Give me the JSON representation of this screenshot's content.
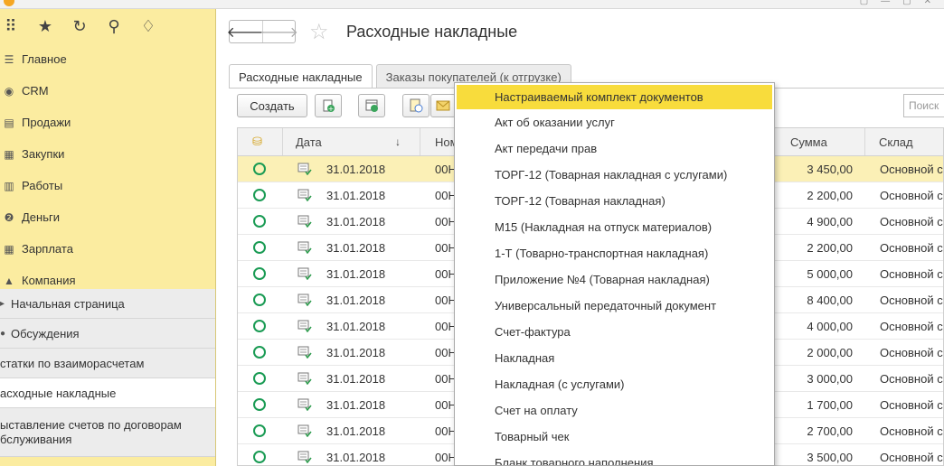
{
  "sidebar": {
    "sections": [
      {
        "label": "Главное",
        "icon": "hamburger-icon"
      },
      {
        "label": "CRM",
        "icon": "crm-icon"
      },
      {
        "label": "Продажи",
        "icon": "sales-icon"
      },
      {
        "label": "Закупки",
        "icon": "purchases-icon"
      },
      {
        "label": "Работы",
        "icon": "works-icon"
      },
      {
        "label": "Деньги",
        "icon": "money-icon"
      },
      {
        "label": "Зарплата",
        "icon": "salary-icon"
      },
      {
        "label": "Компания",
        "icon": "company-icon"
      }
    ],
    "open_windows": [
      {
        "label": "Начальная страница"
      },
      {
        "label": "Обсуждения"
      },
      {
        "label": "статки по взаиморасчетам"
      },
      {
        "label": "асходные накладные"
      },
      {
        "label": "ыставление счетов по договорам бслуживания"
      }
    ]
  },
  "header": {
    "title": "Расходные накладные"
  },
  "tabs": [
    {
      "label": "Расходные накладные"
    },
    {
      "label": "Заказы покупателей (к отгрузке)"
    }
  ],
  "toolbar": {
    "create_label": "Создать",
    "search_placeholder": "Поиск"
  },
  "table": {
    "columns": {
      "date": "Дата",
      "number": "Ном",
      "sum": "Сумма",
      "warehouse": "Склад"
    },
    "rows": [
      {
        "date": "31.01.2018",
        "number": "00Н",
        "sum": "3 450,00",
        "warehouse": "Основной с"
      },
      {
        "date": "31.01.2018",
        "number": "00Н",
        "sum": "2 200,00",
        "warehouse": "Основной с"
      },
      {
        "date": "31.01.2018",
        "number": "00Н",
        "sum": "4 900,00",
        "warehouse": "Основной с"
      },
      {
        "date": "31.01.2018",
        "number": "00Н",
        "sum": "2 200,00",
        "warehouse": "Основной с"
      },
      {
        "date": "31.01.2018",
        "number": "00Н",
        "sum": "5 000,00",
        "warehouse": "Основной с"
      },
      {
        "date": "31.01.2018",
        "number": "00Н",
        "sum": "8 400,00",
        "warehouse": "Основной с"
      },
      {
        "date": "31.01.2018",
        "number": "00Н",
        "sum": "4 000,00",
        "warehouse": "Основной с"
      },
      {
        "date": "31.01.2018",
        "number": "00Н",
        "sum": "2 000,00",
        "warehouse": "Основной с"
      },
      {
        "date": "31.01.2018",
        "number": "00Н",
        "sum": "3 000,00",
        "warehouse": "Основной с"
      },
      {
        "date": "31.01.2018",
        "number": "00Н",
        "sum": "1 700,00",
        "warehouse": "Основной с"
      },
      {
        "date": "31.01.2018",
        "number": "00Н",
        "sum": "2 700,00",
        "warehouse": "Основной с"
      },
      {
        "date": "31.01.2018",
        "number": "00Н",
        "sum": "3 500,00",
        "warehouse": "Основной с"
      }
    ]
  },
  "print_menu": {
    "items": [
      "Настраиваемый комплект документов",
      "Акт об оказании услуг",
      "Акт передачи прав",
      "ТОРГ-12 (Товарная накладная с услугами)",
      "ТОРГ-12 (Товарная накладная)",
      "М15 (Накладная на отпуск материалов)",
      "1-Т (Товарно-транспортная накладная)",
      "Приложение №4 (Товарная накладная)",
      "Универсальный передаточный документ",
      "Счет-фактура",
      "Накладная",
      "Накладная (с услугами)",
      "Счет на оплату",
      "Товарный чек",
      "Бланк товарного наполнения"
    ]
  },
  "colors": {
    "sidebar_bg": "#fbeca0",
    "menu_highlight": "#f8dc3c",
    "selected_row": "#fbf0b6",
    "status_green": "#1a9b54"
  }
}
